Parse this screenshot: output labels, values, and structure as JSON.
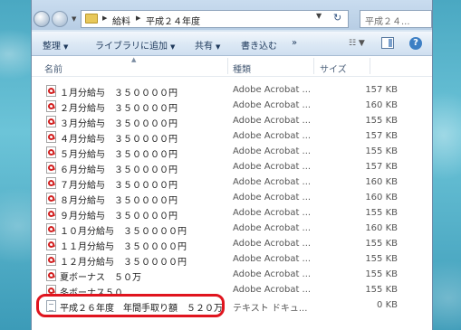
{
  "window": {
    "breadcrumb": [
      "給料",
      "平成２４年度"
    ],
    "search_placeholder": "平成２４..."
  },
  "toolbar": {
    "organize": "整理",
    "add_to_library": "ライブラリに追加",
    "share": "共有",
    "burn": "書き込む"
  },
  "columns": {
    "name": "名前",
    "type": "種類",
    "size": "サイズ"
  },
  "files": [
    {
      "name": "１月分給与　３５００００円",
      "type": "Adobe Acrobat ...",
      "size": "157 KB",
      "icon": "pdf"
    },
    {
      "name": "２月分給与　３５００００円",
      "type": "Adobe Acrobat ...",
      "size": "160 KB",
      "icon": "pdf"
    },
    {
      "name": "３月分給与　３５００００円",
      "type": "Adobe Acrobat ...",
      "size": "155 KB",
      "icon": "pdf"
    },
    {
      "name": "４月分給与　３５００００円",
      "type": "Adobe Acrobat ...",
      "size": "157 KB",
      "icon": "pdf"
    },
    {
      "name": "５月分給与　３５００００円",
      "type": "Adobe Acrobat ...",
      "size": "155 KB",
      "icon": "pdf"
    },
    {
      "name": "６月分給与　３５００００円",
      "type": "Adobe Acrobat ...",
      "size": "157 KB",
      "icon": "pdf"
    },
    {
      "name": "７月分給与　３５００００円",
      "type": "Adobe Acrobat ...",
      "size": "160 KB",
      "icon": "pdf"
    },
    {
      "name": "８月分給与　３５００００円",
      "type": "Adobe Acrobat ...",
      "size": "160 KB",
      "icon": "pdf"
    },
    {
      "name": "９月分給与　３５００００円",
      "type": "Adobe Acrobat ...",
      "size": "155 KB",
      "icon": "pdf"
    },
    {
      "name": "１０月分給与　３５００００円",
      "type": "Adobe Acrobat ...",
      "size": "160 KB",
      "icon": "pdf"
    },
    {
      "name": "１１月分給与　３５００００円",
      "type": "Adobe Acrobat ...",
      "size": "155 KB",
      "icon": "pdf"
    },
    {
      "name": "１２月分給与　３５００００円",
      "type": "Adobe Acrobat ...",
      "size": "155 KB",
      "icon": "pdf"
    },
    {
      "name": "夏ボーナス　５０万",
      "type": "Adobe Acrobat ...",
      "size": "155 KB",
      "icon": "pdf"
    },
    {
      "name": "冬ボーナス５０",
      "type": "Adobe Acrobat ...",
      "size": "155 KB",
      "icon": "pdf"
    },
    {
      "name": "平成２６年度　年間手取り額　５２０万",
      "type": "テキスト ドキュ...",
      "size": "0 KB",
      "icon": "txt"
    }
  ],
  "highlight_color": "#e0141e"
}
